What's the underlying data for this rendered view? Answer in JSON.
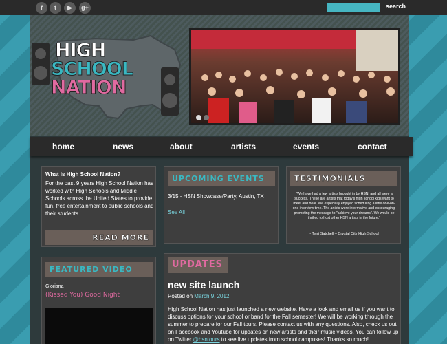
{
  "social": [
    {
      "icon": "facebook-icon",
      "glyph": "f"
    },
    {
      "icon": "twitter-icon",
      "glyph": "t"
    },
    {
      "icon": "youtube-icon",
      "glyph": "▶"
    },
    {
      "icon": "googleplus-icon",
      "glyph": "g+"
    }
  ],
  "search": {
    "button": "search",
    "placeholder": ""
  },
  "logo": {
    "line1": "HIGH",
    "line2": "SCHOOL",
    "line3": "NATION"
  },
  "colors": {
    "teal": "#3ab8c2",
    "pink": "#e06aa0",
    "dark": "#2a2a2a",
    "panel": "#3e3e3e"
  },
  "nav": {
    "items": [
      "home",
      "news",
      "about",
      "artists",
      "events",
      "contact"
    ]
  },
  "about": {
    "title": "What is High School Nation?",
    "text": "For the past 9 years High School Nation has worked with High Schools and Middle Schools across the United States to provide fun, free entertainment to public schools and their students.",
    "read_more": "READ MORE"
  },
  "events": {
    "title": "UPCOMING EVENTS",
    "item": "3/15 - HSN Showcase/Party, Austin, TX",
    "see_all": "See All"
  },
  "testimonials": {
    "title": "TESTIMONIALS",
    "quote": "\"We have had a few artists brought in by HSN, and all were a success. These are artists that today's high school kids want to meet and hear. We especially enjoyed scheduling a little one-on-one interview time. The artists were informative and encouraging, promoting the message to \"achieve your dreams\". We would be thrilled to host other HSN artists in the future.\"",
    "author": "- Terri Satchell – Crystal City High School"
  },
  "featured": {
    "title": "FEATURED VIDEO",
    "artist": "Gloriana",
    "song": "(Kissed You) Good Night"
  },
  "updates": {
    "title": "UPDATES",
    "post_title": "new site launch",
    "posted_on": "Posted on",
    "date": "March 9, 2012",
    "body_pre": "High School Nation has just launched a new website. Have a look and email us if you want to discuss options for your school or band for the Fall semester! We will be working through the summer to prepare for our Fall tours. Please contact us with any questions. Also, check us out on Facebook and Youtube for updates on new artists and their music videos. You can follow up on Twitter ",
    "handle": "@hsntours",
    "body_post": " to see live updates from school campuses! Thanks so much!"
  }
}
